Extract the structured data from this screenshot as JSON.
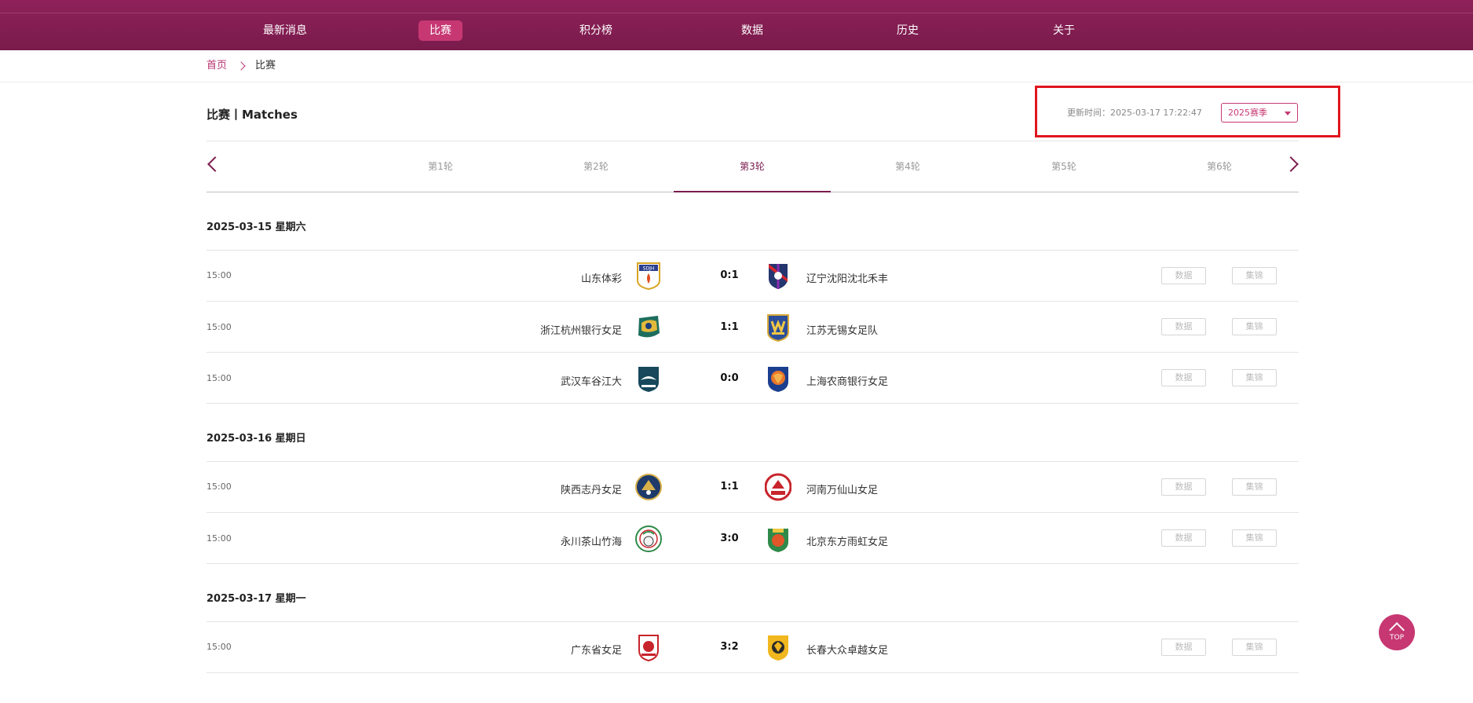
{
  "nav": {
    "items": [
      {
        "label": "最新消息"
      },
      {
        "label": "比赛"
      },
      {
        "label": "积分榜"
      },
      {
        "label": "数据"
      },
      {
        "label": "历史"
      },
      {
        "label": "关于"
      }
    ],
    "active_index": 1
  },
  "breadcrumb": {
    "home": "首页",
    "current": "比赛"
  },
  "page_title": "比赛丨Matches",
  "update_time": "更新时间：2025-03-17 17:22:47",
  "season_select": {
    "value": "2025赛季"
  },
  "rounds": {
    "tabs": [
      "第1轮",
      "第2轮",
      "第3轮",
      "第4轮",
      "第5轮",
      "第6轮"
    ],
    "active_index": 2
  },
  "groups": [
    {
      "date": "2025-03-15 星期六",
      "matches": [
        {
          "time": "15:00",
          "home": "山东体彩",
          "score": "0:1",
          "away": "辽宁沈阳沈北禾丰"
        },
        {
          "time": "15:00",
          "home": "浙江杭州银行女足",
          "score": "1:1",
          "away": "江苏无锡女足队"
        },
        {
          "time": "15:00",
          "home": "武汉车谷江大",
          "score": "0:0",
          "away": "上海农商银行女足"
        }
      ]
    },
    {
      "date": "2025-03-16 星期日",
      "matches": [
        {
          "time": "15:00",
          "home": "陕西志丹女足",
          "score": "1:1",
          "away": "河南万仙山女足"
        },
        {
          "time": "15:00",
          "home": "永川茶山竹海",
          "score": "3:0",
          "away": "北京东方雨虹女足"
        }
      ]
    },
    {
      "date": "2025-03-17 星期一",
      "matches": [
        {
          "time": "15:00",
          "home": "广东省女足",
          "score": "3:2",
          "away": "长春大众卓越女足"
        }
      ]
    }
  ],
  "row_buttons": {
    "data_label": "数据",
    "highlights_label": "集锦"
  },
  "top_button": {
    "label": "TOP"
  },
  "colors": {
    "brand": "#7a1b4c",
    "accent": "#c73873",
    "highlight_box": "#e0161d"
  }
}
